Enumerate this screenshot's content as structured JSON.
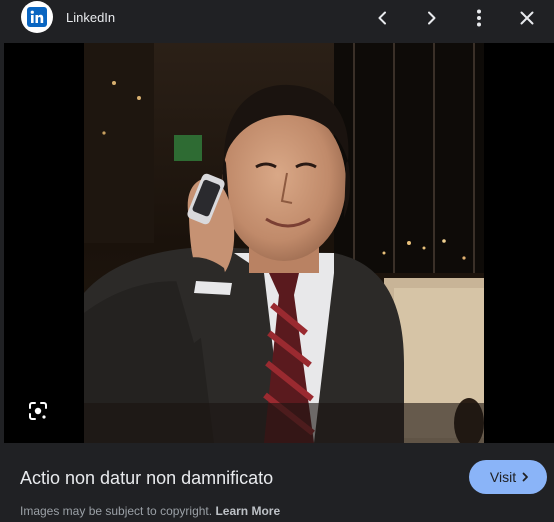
{
  "header": {
    "source_name": "LinkedIn",
    "favicon": "linkedin-logo-icon",
    "buttons": [
      "chevron-left-icon",
      "chevron-right-icon",
      "more-vert-icon",
      "close-icon"
    ]
  },
  "image": {
    "subject": "photo of a man in a dark suit and striped tie talking on a mobile phone",
    "lens_icon": "lens-search-icon"
  },
  "caption": {
    "title": "Actio non datur non damnificato"
  },
  "visit_button": {
    "label": "Visit",
    "icon": "chevron-right-icon"
  },
  "footer": {
    "copyright_text": "Images may be subject to copyright.",
    "learn_more": "Learn More"
  },
  "colors": {
    "background": "#202124",
    "text": "#e8eaed",
    "muted": "#9aa0a6",
    "accent": "#8ab4f8",
    "linkedin": "#0a66c2"
  }
}
